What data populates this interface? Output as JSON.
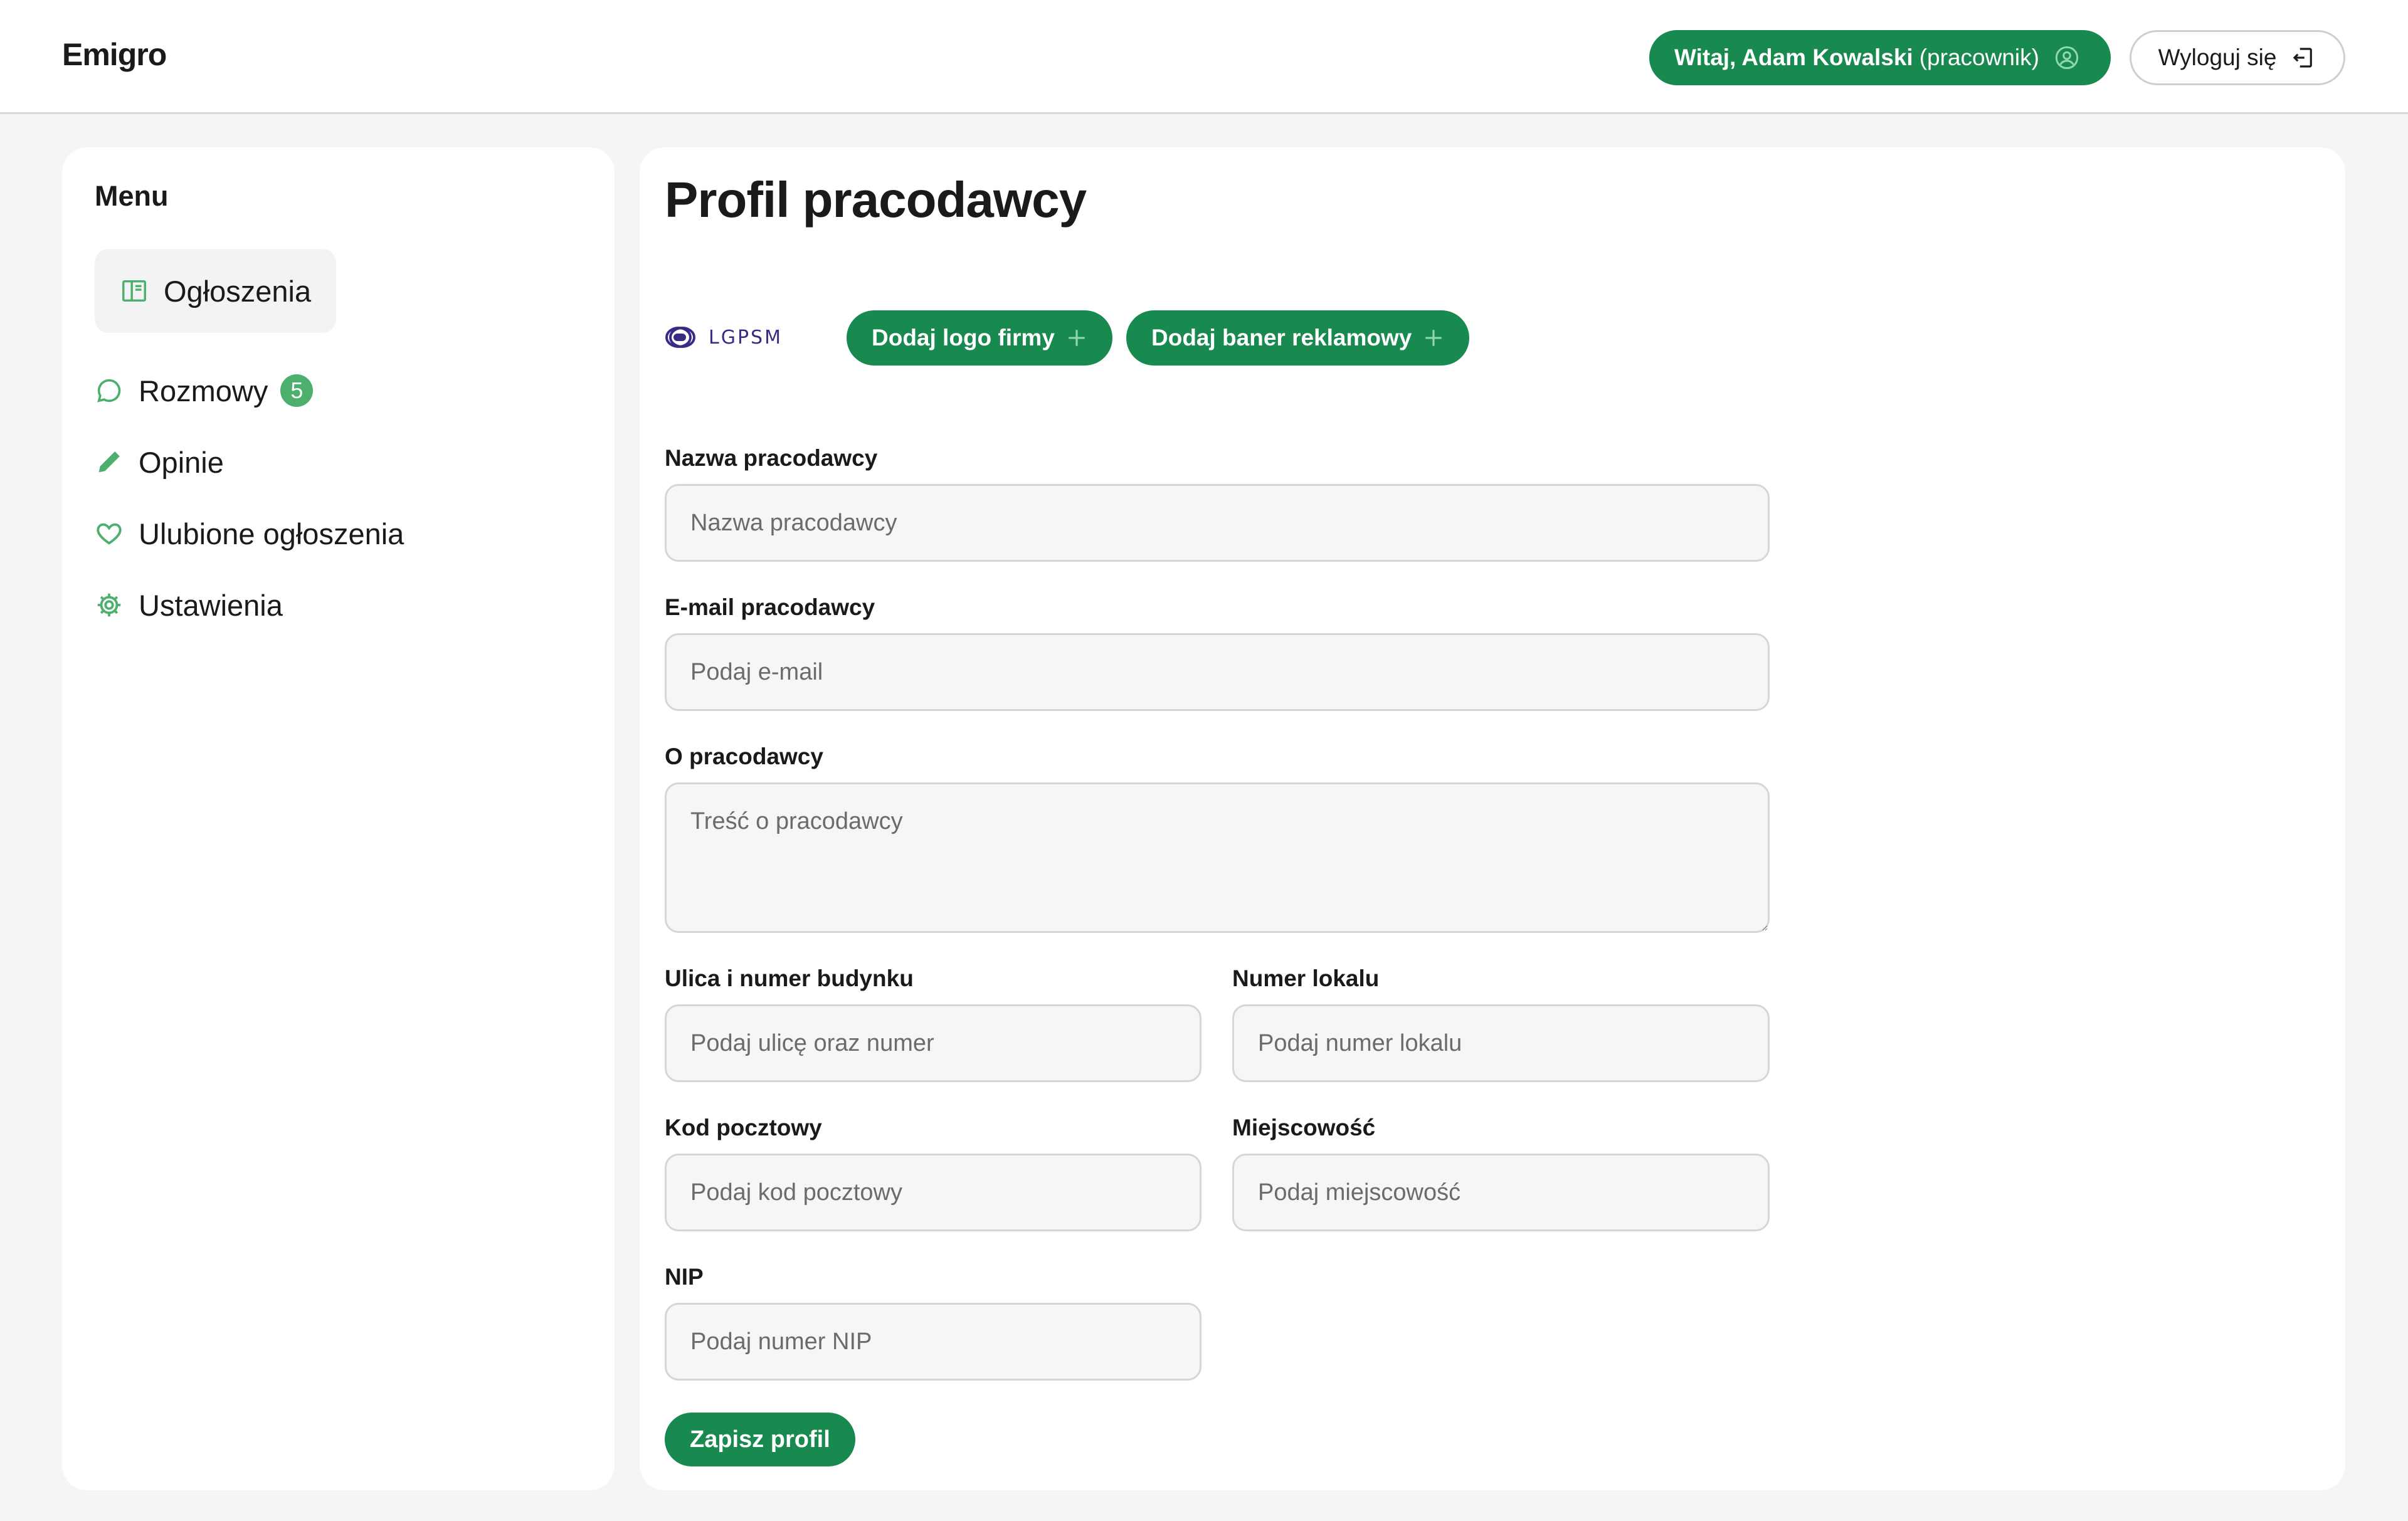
{
  "header": {
    "brand": "Emigro",
    "greeting_strong": "Witaj, Adam Kowalski",
    "greeting_role": "(pracownik)",
    "logout_label": "Wyloguj się"
  },
  "sidebar": {
    "title": "Menu",
    "items": [
      {
        "label": "Ogłoszenia",
        "icon": "layout-icon",
        "active": true
      },
      {
        "label": "Rozmowy",
        "icon": "chat-bubble-icon",
        "badge": "5"
      },
      {
        "label": "Opinie",
        "icon": "pencil-icon"
      },
      {
        "label": "Ulubione ogłoszenia",
        "icon": "heart-icon"
      },
      {
        "label": "Ustawienia",
        "icon": "gear-icon"
      }
    ]
  },
  "main": {
    "title": "Profil pracodawcy",
    "logo_text": "LGPSM",
    "add_logo_label": "Dodaj logo firmy",
    "add_banner_label": "Dodaj baner reklamowy",
    "fields": {
      "name": {
        "label": "Nazwa pracodawcy",
        "placeholder": "Nazwa pracodawcy",
        "value": ""
      },
      "email": {
        "label": "E-mail pracodawcy",
        "placeholder": "Podaj e-mail",
        "value": ""
      },
      "about": {
        "label": "O pracodawcy",
        "placeholder": "Treść o pracodawcy",
        "value": ""
      },
      "street": {
        "label": "Ulica i numer budynku",
        "placeholder": "Podaj ulicę oraz numer",
        "value": ""
      },
      "unit": {
        "label": "Numer lokalu",
        "placeholder": "Podaj numer lokalu",
        "value": ""
      },
      "postal": {
        "label": "Kod pocztowy",
        "placeholder": "Podaj kod pocztowy",
        "value": ""
      },
      "city": {
        "label": "Miejscowość",
        "placeholder": "Podaj miejscowość",
        "value": ""
      },
      "nip": {
        "label": "NIP",
        "placeholder": "Podaj numer NIP",
        "value": ""
      }
    },
    "save_label": "Zapisz profil"
  },
  "colors": {
    "accent": "#188a4f",
    "accent_light": "#4caf6e",
    "page_bg": "#f5f5f5",
    "field_bg": "#f6f6f6",
    "logo_color": "#3b2a85"
  }
}
